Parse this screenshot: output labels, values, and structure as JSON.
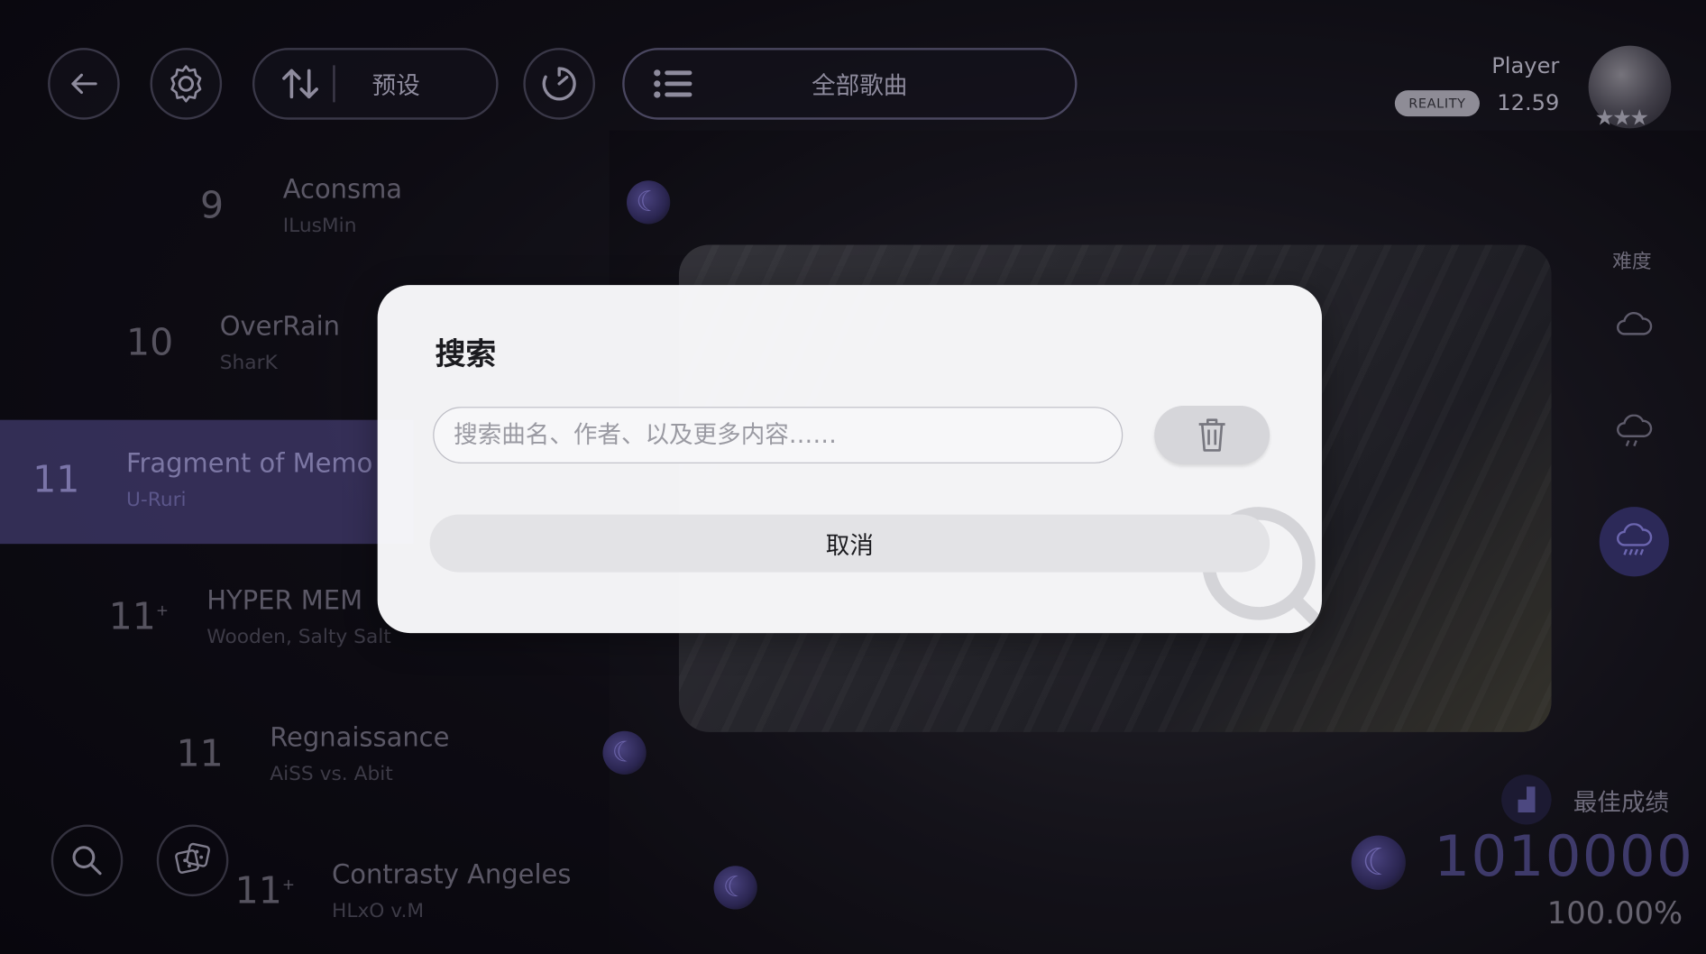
{
  "topbar": {
    "back_icon": "arrow-left-icon",
    "settings_icon": "gear-icon",
    "sort_icon": "sort-icon",
    "preset_label": "预设",
    "timer_icon": "timer-icon",
    "list_icon": "list-icon",
    "collection_label": "全部歌曲"
  },
  "player": {
    "name": "Player",
    "badge": "REALITY",
    "rks": "12.59",
    "avatar_icon": "avatar",
    "stars": "★★★"
  },
  "songs": [
    {
      "level": "9",
      "level_plus": "",
      "title": "Aconsma",
      "artist": "ILusMin"
    },
    {
      "level": "10",
      "level_plus": "",
      "title": "OverRain",
      "artist": "SharK"
    },
    {
      "level": "11",
      "level_plus": "",
      "title": "Fragment of Memo",
      "artist": "U-Ruri"
    },
    {
      "level": "11",
      "level_plus": "+",
      "title": "HYPER MEM",
      "artist": "Wooden, Salty Salt"
    },
    {
      "level": "11",
      "level_plus": "",
      "title": "Regnaissance",
      "artist": "AiSS vs. Abit"
    },
    {
      "level": "11",
      "level_plus": "+",
      "title": "Contrasty Angeles",
      "artist": "HLxO v.M"
    }
  ],
  "difficulty": {
    "label": "难度",
    "levels": [
      "cloud-icon",
      "cloud-drizzle-icon",
      "cloud-rain-icon"
    ]
  },
  "best": {
    "label": "最佳成绩",
    "score": "1010000",
    "accuracy": "100.00%"
  },
  "bottom": {
    "search_icon": "search-icon",
    "random_icon": "dice-icon"
  },
  "modal": {
    "title": "搜索",
    "search_placeholder": "搜索曲名、作者、以及更多内容……",
    "search_value": "",
    "clear_icon": "trash-icon",
    "cancel_label": "取消"
  },
  "colors": {
    "accent": "#4e4684",
    "modal_bg": "#fafafc",
    "button_grey": "#e3e3e6"
  }
}
